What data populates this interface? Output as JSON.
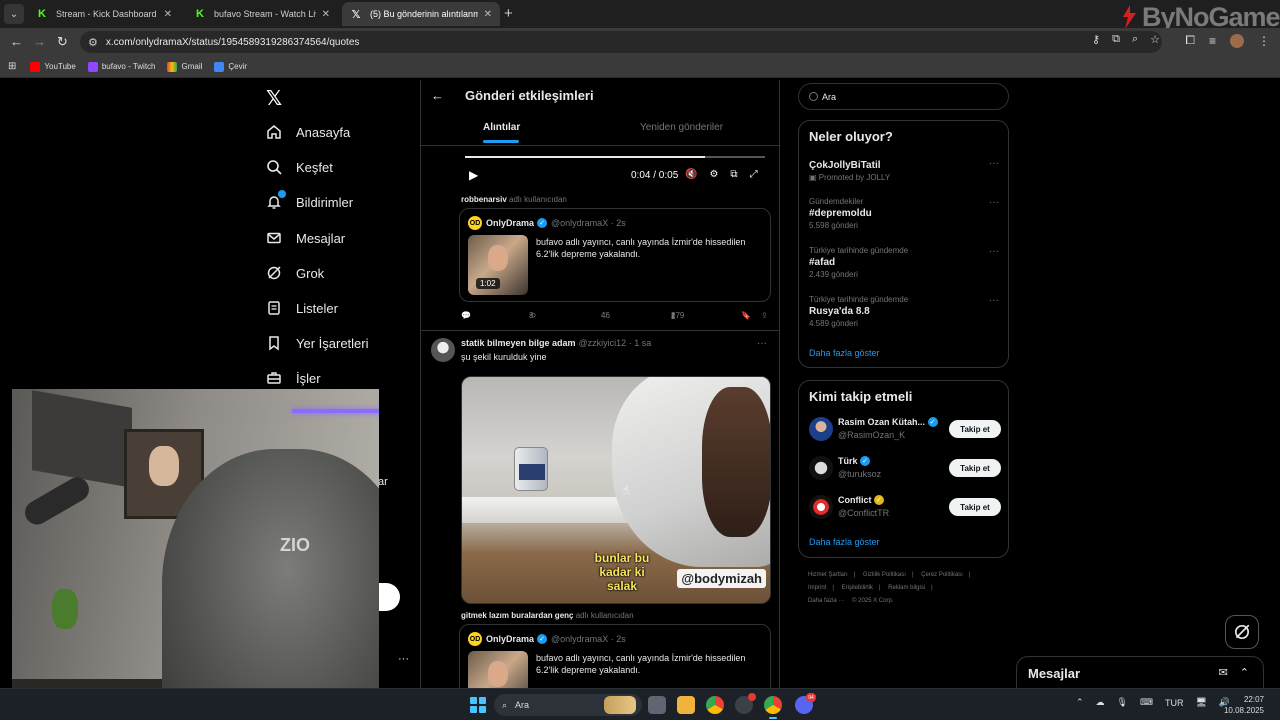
{
  "browser": {
    "tabs": [
      {
        "title": "Stream - Kick Dashboard",
        "active": false
      },
      {
        "title": "bufavo Stream - Watch Live on",
        "active": false
      },
      {
        "title": "(5) Bu gönderinin alıntılanm",
        "active": true
      }
    ],
    "url": "x.com/onlydramaX/status/1954589319286374564/quotes",
    "bookmarks": [
      "YouTube",
      "bufavo - Twitch",
      "Gmail",
      "Çevir"
    ],
    "brand": "ByNoGame"
  },
  "nav": {
    "items": [
      "Anasayfa",
      "Keşfet",
      "Bildirimler",
      "Mesajlar",
      "Grok",
      "Listeler",
      "Yer İşaretleri",
      "İşler"
    ]
  },
  "main": {
    "header_title": "Gönderi etkileşimleri",
    "tabs": [
      "Alıntılar",
      "Yeniden gönderiler"
    ],
    "video": {
      "time": "0:04 / 0:05",
      "progress": 0.8
    },
    "reply_label_1": {
      "user": "robbenarsiv",
      "suffix": "adlı kullanıcıdan"
    },
    "quote_1": {
      "name": "OnlyDrama",
      "handle": "@onlydramaX · 2s",
      "text": "bufavo adlı yayıncı, canlı yayında İzmir'de hissedilen 6.2'lik depreme yakalandı.",
      "duration": "1:02"
    },
    "actions_1": {
      "retweets": "3",
      "likes": "46",
      "views": "279"
    },
    "tweet_2": {
      "name": "statik bilmeyen bilge adam",
      "meta": "@zzkiyici12 · 1 sa",
      "text": "şu şekil kurulduk yine",
      "caption": "bunlar bu\nkadar ki\nsalak",
      "watermark": "@bodymizah"
    },
    "reply_label_2": {
      "user": "gitmek lazım buralardan genç",
      "suffix": "adlı kullanıcıdan"
    },
    "quote_2": {
      "name": "OnlyDrama",
      "handle": "@onlydramaX · 2s",
      "text": "bufavo adlı yayıncı, canlı yayında İzmir'de hissedilen 6.2'lik depreme yakalandı."
    }
  },
  "sidebar": {
    "search_placeholder": "Ara",
    "trends_title": "Neler oluyor?",
    "trends": [
      {
        "context": "",
        "title": "ÇokJollyBiTatil",
        "count": "Promoted by JOLLY"
      },
      {
        "context": "Gündemdekiler",
        "title": "#depremoldu",
        "count": "5.598 gönderi"
      },
      {
        "context": "Türkiye tarihinde gündemde",
        "title": "#afad",
        "count": "2.439 gönderi"
      },
      {
        "context": "Türkiye tarihinde gündemde",
        "title": "Rusya'da 8.8",
        "count": "4.589 gönderi"
      }
    ],
    "show_more": "Daha fazla göster",
    "follow_title": "Kimi takip etmeli",
    "follow": [
      {
        "name": "Rasim Ozan Kütah...",
        "handle": "@RasimOzan_K",
        "badge": "blue"
      },
      {
        "name": "Türk",
        "handle": "@turuksoz",
        "badge": "blue"
      },
      {
        "name": "Conflict",
        "handle": "@ConflictTR",
        "badge": "gold"
      }
    ],
    "follow_button": "Takip et",
    "footer": [
      "Hizmet Şartları",
      "Gizlilik Politikası",
      "Çerez Politikası",
      "Imprint",
      "Erişilebilirlik",
      "Reklam bilgisi",
      "Daha fazla ···",
      "© 2025 X Corp."
    ]
  },
  "overlay": {
    "stray_text": "ar",
    "messages_label": "Mesajlar"
  },
  "taskbar": {
    "search": "Ara",
    "lang": "TUR",
    "time": "22:07",
    "date": "10.08.2025",
    "discord_badge": "94"
  }
}
